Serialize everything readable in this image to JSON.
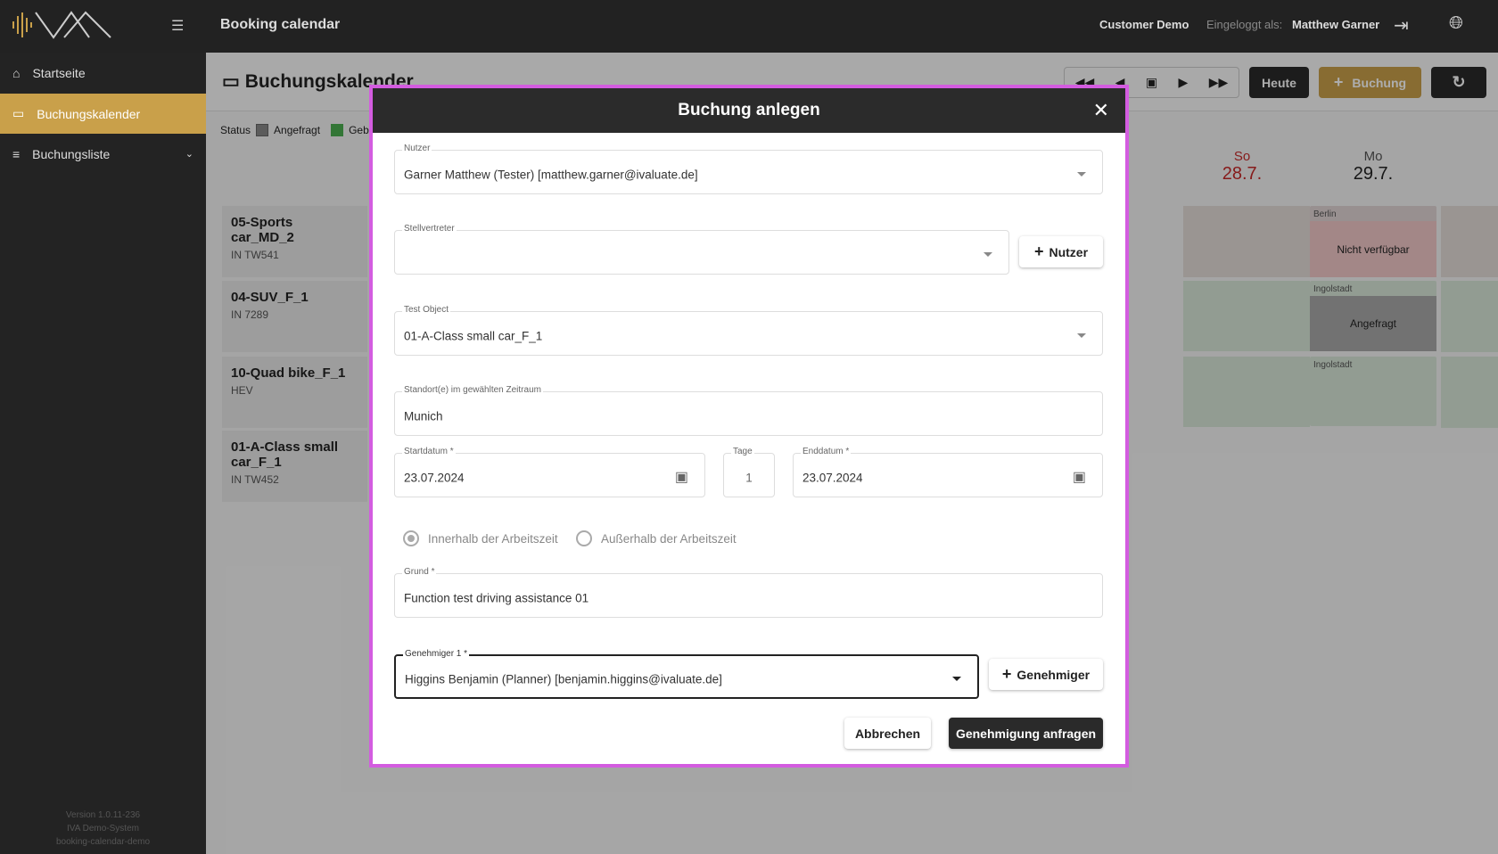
{
  "topbar": {
    "title": "Booking calendar",
    "customer": "Customer Demo",
    "logged_in_label": "Eingeloggt als:",
    "user": "Matthew Garner"
  },
  "sidebar": {
    "items": [
      {
        "label": "Startseite"
      },
      {
        "label": "Buchungskalender",
        "active": true
      },
      {
        "label": "Buchungsliste"
      }
    ],
    "footer": [
      "Version 1.0.11-236",
      "IVA Demo-System",
      "booking-calendar-demo"
    ]
  },
  "colors": {
    "accent": "#c9a04a",
    "dialog_outline": "#d35ce0",
    "weekend": "#c62828"
  },
  "main": {
    "title": "Buchungskalender",
    "status_label": "Status",
    "legend": [
      {
        "label": "Angefragt",
        "color": "#888888"
      },
      {
        "label": "Gebucht",
        "color": "#4caf50"
      }
    ],
    "toolbar": {
      "today": "Heute",
      "booking": "Buchung"
    },
    "days": [
      {
        "day": "So",
        "date": "28.7.",
        "weekend": true
      },
      {
        "day": "Mo",
        "date": "29.7."
      }
    ],
    "objects": [
      {
        "name": "05-Sports car_MD_2",
        "sub": "IN TW541"
      },
      {
        "name": "04-SUV_F_1",
        "sub": "IN 7289"
      },
      {
        "name": "10-Quad bike_F_1",
        "sub": "HEV"
      },
      {
        "name": "01-A-Class small car_F_1",
        "sub": "IN TW452"
      }
    ],
    "cells": [
      {
        "location": "Berlin",
        "status": "Nicht verfügbar"
      },
      {
        "location": "Ingolstadt",
        "status": "Angefragt"
      },
      {
        "location": "Ingolstadt",
        "status": ""
      }
    ]
  },
  "dialog": {
    "title": "Buchung anlegen",
    "user": {
      "label": "Nutzer",
      "value": "Garner Matthew (Tester) [matthew.garner@ivaluate.de]"
    },
    "deputy": {
      "label": "Stellvertreter",
      "value": ""
    },
    "add_user": "Nutzer",
    "object": {
      "label": "Test Object",
      "value": "01-A-Class small car_F_1"
    },
    "location": {
      "label": "Standort(e) im gewählten Zeitraum",
      "value": "Munich"
    },
    "start": {
      "label": "Startdatum *",
      "value": "23.07.2024"
    },
    "days": {
      "label": "Tage",
      "value": "1"
    },
    "end": {
      "label": "Enddatum *",
      "value": "23.07.2024"
    },
    "radio_inside": "Innerhalb der Arbeitszeit",
    "radio_outside": "Außerhalb der Arbeitszeit",
    "radio_selected": "inside",
    "reason": {
      "label": "Grund *",
      "value": "Function test driving assistance 01"
    },
    "approver": {
      "label": "Genehmiger 1 *",
      "value": "Higgins Benjamin (Planner) [benjamin.higgins@ivaluate.de]"
    },
    "add_approver": "Genehmiger",
    "cancel": "Abbrechen",
    "submit": "Genehmigung anfragen"
  }
}
